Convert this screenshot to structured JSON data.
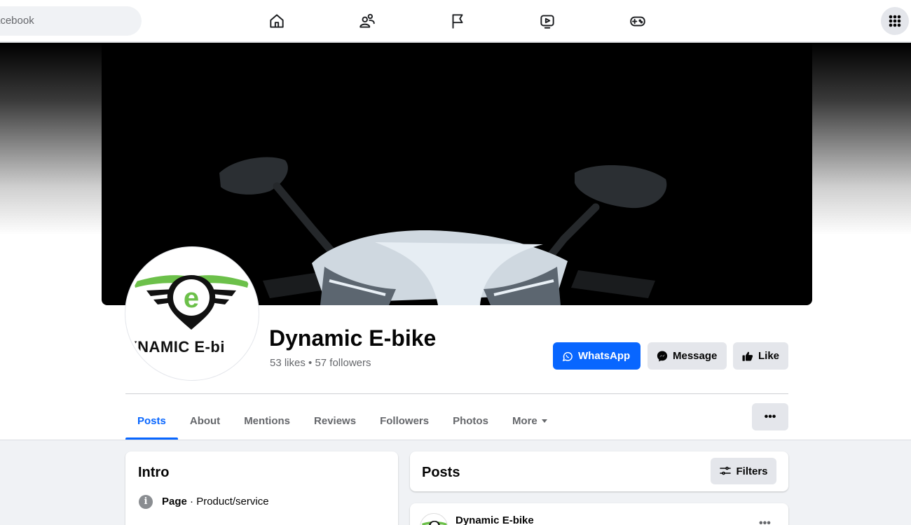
{
  "topbar": {
    "search_placeholder": "acebook",
    "nav_icons": [
      "home-icon",
      "friends-icon",
      "flag-icon",
      "watch-icon",
      "gaming-icon"
    ],
    "menu_icon": "grid-menu-icon"
  },
  "page": {
    "name": "Dynamic E-bike",
    "stats": "53 likes • 57 followers",
    "logo_text": "YNAMIC E-bi"
  },
  "actions": {
    "whatsapp": "WhatsApp",
    "message": "Message",
    "like": "Like"
  },
  "tabs": [
    {
      "label": "Posts",
      "active": true
    },
    {
      "label": "About",
      "active": false
    },
    {
      "label": "Mentions",
      "active": false
    },
    {
      "label": "Reviews",
      "active": false
    },
    {
      "label": "Followers",
      "active": false
    },
    {
      "label": "Photos",
      "active": false
    },
    {
      "label": "More",
      "active": false
    }
  ],
  "tab_more_button": "•••",
  "intro": {
    "title": "Intro",
    "category_label": "Page",
    "category_value": " · Product/service"
  },
  "posts": {
    "title": "Posts",
    "filters_label": "Filters",
    "first_post_author": "Dynamic E-bike",
    "more": "•••"
  },
  "colors": {
    "accent": "#0866ff",
    "logo_green": "#6cc04a",
    "background": "#f0f2f5"
  }
}
